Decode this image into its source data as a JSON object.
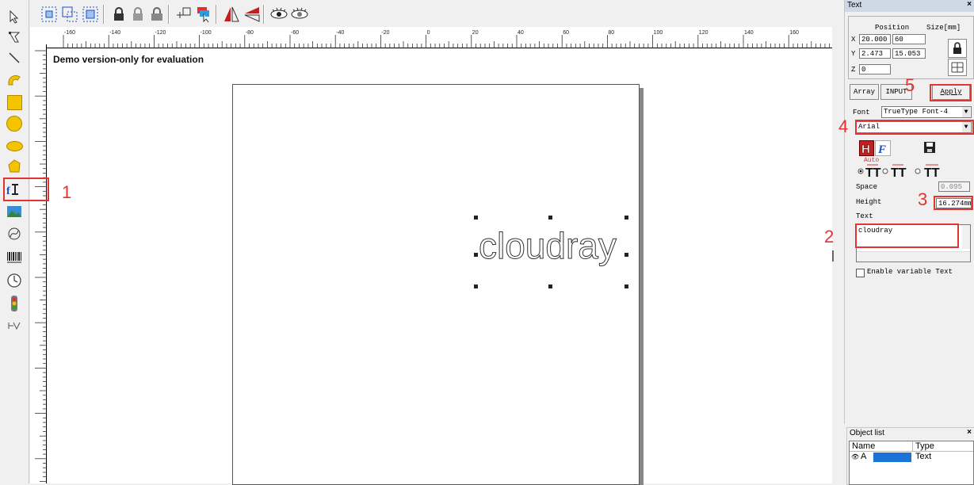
{
  "canvas": {
    "watermark": "Demo version-only for evaluation",
    "text_object": "cloudray"
  },
  "ruler": {
    "h_ticks": [
      "-160",
      "-140",
      "-120",
      "-100",
      "-80",
      "-60",
      "-40",
      "-20",
      "0",
      "20",
      "40",
      "60",
      "80",
      "100",
      "120",
      "140",
      "160"
    ]
  },
  "left_toolbar": {
    "tools": [
      "select-pointer-icon",
      "node-edit-icon",
      "line-icon",
      "curve-icon",
      "rectangle-icon",
      "circle-icon",
      "ellipse-icon",
      "polygon-icon",
      "text-tool-icon",
      "bitmap-icon",
      "vector-file-icon",
      "barcode-icon",
      "timer-icon",
      "io-port-icon",
      "delay-icon"
    ]
  },
  "text_panel": {
    "title": "Text",
    "close": "×",
    "position_header": "Position",
    "size_header": "Size[mm]",
    "x_label": "X",
    "y_label": "Y",
    "z_label": "Z",
    "x_value": "20.000",
    "y_value": "2.473",
    "z_value": "0",
    "width_value": "60",
    "height_value": "15.053",
    "array_button": "Array",
    "input_button": "INPUT",
    "apply_button": "Apply",
    "font_label": "Font",
    "font_type": "TrueType Font-4",
    "font_name": "Arial",
    "auto_label": "Auto",
    "space_label": "Space",
    "space_value": "0.095",
    "height_label": "Height",
    "text_height_value": "16.274mm",
    "text_label": "Text",
    "text_value": "cloudray",
    "enable_variable_text": "Enable variable Text"
  },
  "annotations": {
    "n1": "1",
    "n2": "2",
    "n3": "3",
    "n4": "4",
    "n5": "5",
    "color": "#e0362f"
  },
  "object_list": {
    "title": "Object list",
    "close": "×",
    "col_name": "Name",
    "col_type": "Type",
    "row_name": "A",
    "row_type": "Text",
    "selected_color": "#1a73d9"
  }
}
